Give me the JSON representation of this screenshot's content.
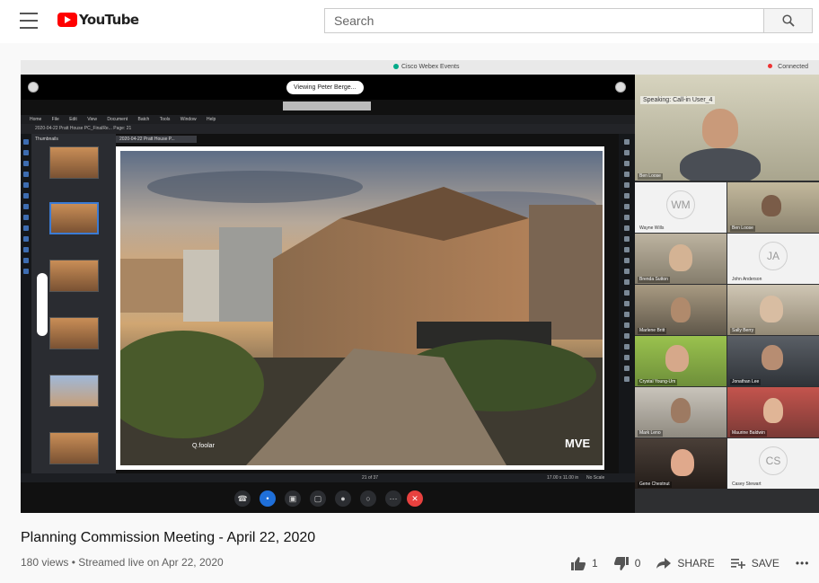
{
  "header": {
    "logo_text": "YouTube",
    "search_placeholder": "Search"
  },
  "webex": {
    "window_title": "Cisco Webex Events",
    "status": "Connected",
    "viewing_label": "Viewing Peter Berge...",
    "menu": [
      "Home",
      "File",
      "Edit",
      "View",
      "Document",
      "Batch",
      "Tools",
      "Window",
      "Help"
    ],
    "path": "2020-04-22 Pratt House PC_FinalRe...  Page: 21",
    "thumbnails_label": "Thumbnails",
    "doc_tab": "2020-04-22 Pratt House P...",
    "render_brand": "MVE",
    "render_credit": "Q.foolar",
    "zoom": "17.00 x 11.00 in",
    "page_num": "21 of 37",
    "no_scale": "No Scale"
  },
  "participants": {
    "speaking_label": "Speaking:",
    "speaking_name": "Call-in User_4",
    "tiles": [
      {
        "name": "Ben Loose",
        "initials": ""
      },
      {
        "name": "Wayne Wills",
        "initials": "WM"
      },
      {
        "name": "Ben Loose",
        "initials": ""
      },
      {
        "name": "Brenda Sutton",
        "initials": ""
      },
      {
        "name": "John Anderson",
        "initials": "JA"
      },
      {
        "name": "Marlene Britt",
        "initials": ""
      },
      {
        "name": "Sally Berry",
        "initials": ""
      },
      {
        "name": "Crystal Young-Um",
        "initials": ""
      },
      {
        "name": "Jonathan Lee",
        "initials": ""
      },
      {
        "name": "Mark Leno",
        "initials": ""
      },
      {
        "name": "Maurine Baldwin",
        "initials": ""
      },
      {
        "name": "Gene Chestnut",
        "initials": ""
      },
      {
        "name": "Casey Stewart",
        "initials": "CS"
      }
    ]
  },
  "video": {
    "title": "Planning Commission Meeting - April 22, 2020",
    "meta": "180 views • Streamed live on Apr 22, 2020",
    "likes": "1",
    "dislikes": "0",
    "share_label": "SHARE",
    "save_label": "SAVE",
    "more_label": "•••"
  },
  "colors": {
    "youtube_red": "#ff0000",
    "hangup_red": "#e8413f",
    "webex_blue": "#1f6fd9"
  }
}
